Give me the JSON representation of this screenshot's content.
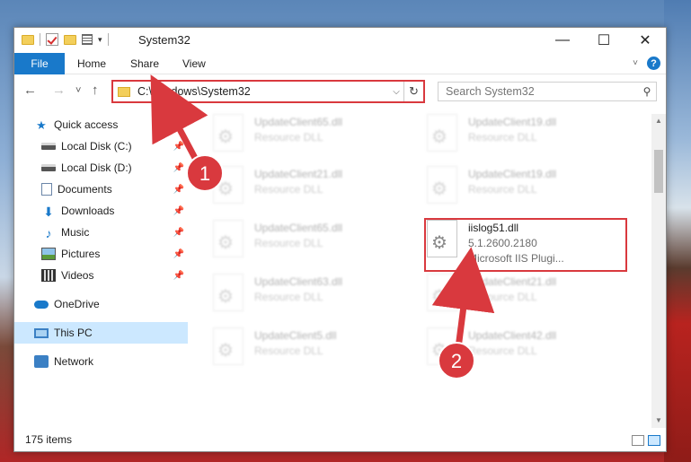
{
  "window": {
    "title": "System32",
    "controls": {
      "minimize": "—",
      "maximize": "☐",
      "close": "✕"
    }
  },
  "ribbon": {
    "tabs": [
      "File",
      "Home",
      "Share",
      "View"
    ]
  },
  "nav": {
    "back": "←",
    "forward": "→",
    "recent": "˅",
    "up": "↑",
    "address": "C:\\Windows\\System32",
    "search_placeholder": "Search System32"
  },
  "sidebar": {
    "items": [
      {
        "label": "Quick access",
        "icon": "star-icon",
        "pinned": false
      },
      {
        "label": "Local Disk (C:)",
        "icon": "drive-icon",
        "pinned": true
      },
      {
        "label": "Local Disk (D:)",
        "icon": "drive-icon",
        "pinned": true
      },
      {
        "label": "Documents",
        "icon": "document-icon",
        "pinned": true
      },
      {
        "label": "Downloads",
        "icon": "download-icon",
        "pinned": true
      },
      {
        "label": "Music",
        "icon": "music-icon",
        "pinned": true
      },
      {
        "label": "Pictures",
        "icon": "pictures-icon",
        "pinned": true
      },
      {
        "label": "Videos",
        "icon": "video-icon",
        "pinned": true
      },
      {
        "label": "OneDrive",
        "icon": "cloud-icon",
        "pinned": false
      },
      {
        "label": "This PC",
        "icon": "computer-icon",
        "pinned": false,
        "selected": true
      },
      {
        "label": "Network",
        "icon": "network-icon",
        "pinned": false
      }
    ]
  },
  "files": [
    {
      "name": "UpdateClient65.dll",
      "desc": "Resource DLL"
    },
    {
      "name": "UpdateClient19.dll",
      "desc": "Resource DLL"
    },
    {
      "name": "UpdateClient21.dll",
      "desc": "Resource DLL"
    },
    {
      "name": "UpdateClient19.dll",
      "desc": "Resource DLL"
    },
    {
      "name": "UpdateClient65.dll",
      "desc": "Resource DLL"
    },
    {
      "name": "iislog51.dll",
      "version": "5.1.2600.2180",
      "desc": "Microsoft IIS Plugi..."
    },
    {
      "name": "UpdateClient63.dll",
      "desc": "Resource DLL"
    },
    {
      "name": "UpdateClient21.dll",
      "desc": "Resource DLL"
    },
    {
      "name": "UpdateClient5.dll",
      "desc": "Resource DLL"
    },
    {
      "name": "UpdateClient42.dll",
      "desc": "Resource DLL"
    }
  ],
  "callouts": [
    "1",
    "2"
  ],
  "status": {
    "item_count": "175 items"
  },
  "colors": {
    "accent": "#1979ca",
    "highlight": "#d9393e",
    "selected_bg": "#cce8ff"
  }
}
